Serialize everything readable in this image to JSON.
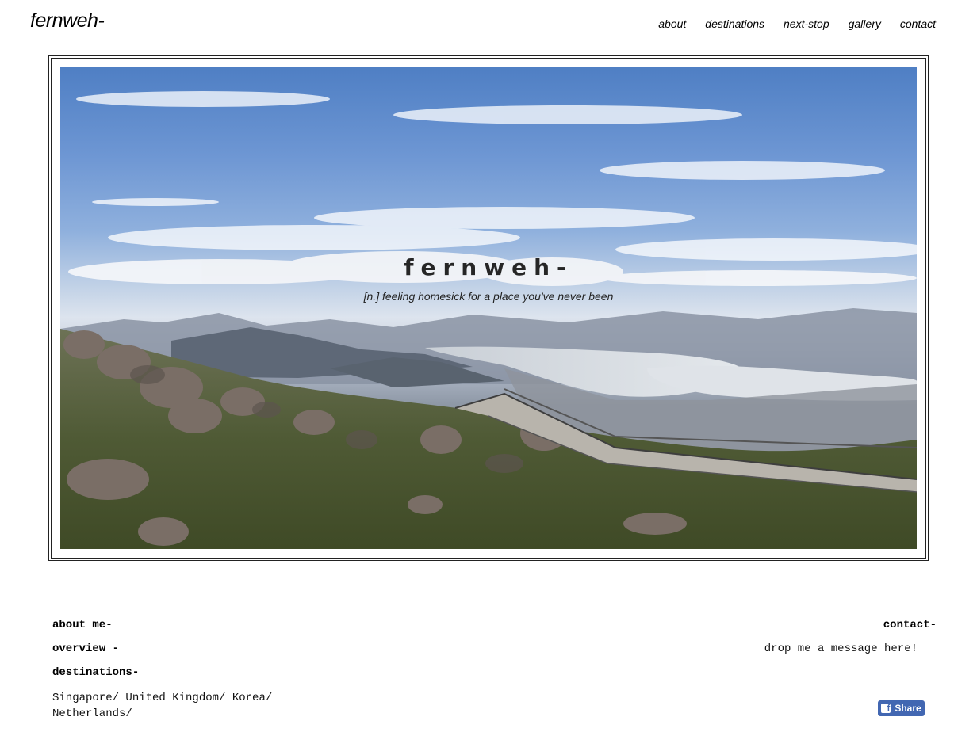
{
  "header": {
    "logo": "fernweh-",
    "nav": [
      "about",
      "destinations",
      "next-stop",
      "gallery",
      "contact"
    ]
  },
  "hero": {
    "title": "fernweh-",
    "subtitle": "[n.] feeling homesick for a place you've never been"
  },
  "footer": {
    "about_heading": "about me-",
    "overview_heading": "overview -",
    "destinations_heading": "destinations-",
    "destinations_list": "Singapore/ United Kingdom/ Korea/ Netherlands/",
    "contact_heading": "contact-",
    "contact_message": "drop me a message here!",
    "share_label": "Share"
  },
  "colors": {
    "share_button": "#4267b2",
    "text": "#111111"
  }
}
